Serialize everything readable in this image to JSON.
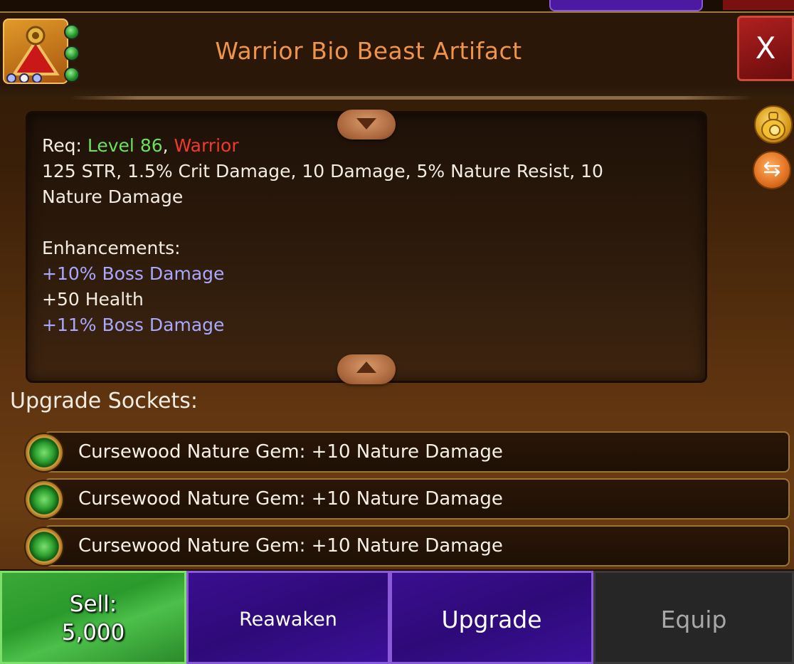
{
  "header": {
    "title": "Warrior Bio Beast Artifact",
    "close_label": "X",
    "item_icon": "warrior-artifact-icon"
  },
  "side_icons": [
    "money-bag-icon",
    "swap-icon"
  ],
  "description": {
    "req_prefix": "Req:",
    "req_level": "Level 86",
    "req_sep": ",",
    "req_class": "Warrior",
    "stats_line1": "125 STR, 1.5% Crit Damage, 10 Damage, 5% Nature Resist, 10",
    "stats_line2": "Nature Damage",
    "enhancements_label": "Enhancements:",
    "enhancements": [
      {
        "text": "+10% Boss Damage",
        "color": "#a8a8ff"
      },
      {
        "text": "+50 Health",
        "color": "#f2ece2"
      },
      {
        "text": "+11% Boss Damage",
        "color": "#a8a8ff"
      }
    ]
  },
  "sockets": {
    "label": "Upgrade Sockets:",
    "items": [
      {
        "text": "Cursewood Nature Gem: +10 Nature Damage",
        "icon": "nature-gem-icon"
      },
      {
        "text": "Cursewood Nature Gem: +10 Nature Damage",
        "icon": "nature-gem-icon"
      },
      {
        "text": "Cursewood Nature Gem: +10 Nature Damage",
        "icon": "nature-gem-icon"
      }
    ]
  },
  "buttons": {
    "sell_label": "Sell:",
    "sell_value": "5,000",
    "reawaken": "Reawaken",
    "upgrade": "Upgrade",
    "equip": "Equip"
  },
  "colors": {
    "title": "#f0944a",
    "level": "#6ce05a",
    "class_req": "#f03a2a",
    "enhancement_blue": "#a8a8ff",
    "sell_green": "#3aa838",
    "action_purple": "#2e0a78",
    "equip_disabled": "#262626"
  }
}
